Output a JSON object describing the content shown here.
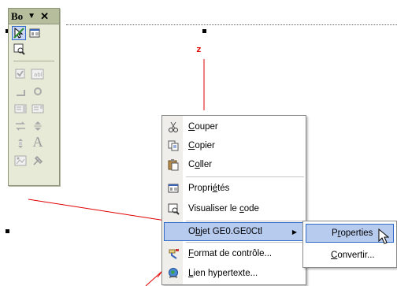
{
  "toolbox": {
    "title": "Bo",
    "title_dropdown": "▼",
    "close": "✕",
    "tools": [
      "select-objects-icon",
      "properties-icon",
      "view-code-icon",
      "checkbox-icon",
      "textbox-icon",
      "line-icon",
      "radio-icon",
      "listbox-icon",
      "combobox-icon",
      "scrollbar-icon",
      "spinner-icon",
      "scroll-icon",
      "label-icon",
      "image-icon",
      "more-controls-icon"
    ]
  },
  "canvas": {
    "axis_label": "z"
  },
  "context_menu": {
    "items": [
      {
        "icon": "scissors-icon",
        "label": "Couper",
        "accel": "C",
        "rest": "ouper"
      },
      {
        "icon": "copy-icon",
        "label": "Copier",
        "accel": "C",
        "rest": "opier"
      },
      {
        "icon": "paste-icon",
        "label": "Coller",
        "pre": "C",
        "accel": "o",
        "rest": "ller"
      },
      {
        "icon": "properties-icon",
        "label": "Propriétés",
        "pre": "Propri",
        "accel": "é",
        "rest": "tés"
      },
      {
        "icon": "view-code-icon",
        "label": "Visualiser le code",
        "pre": "Visualiser le ",
        "accel": "c",
        "rest": "ode"
      },
      {
        "icon": "",
        "label": "Objet GE0.GE0Ctl",
        "pre": "O",
        "accel": "b",
        "rest": "jet GE0.GE0Ctl",
        "selected": true
      },
      {
        "icon": "format-brush-icon",
        "label": "Format de contrôle...",
        "accel": "F",
        "rest": "ormat de contrôle..."
      },
      {
        "icon": "hyperlink-globe-icon",
        "label": "Lien hypertexte...",
        "accel": "L",
        "rest": "ien hypertexte..."
      }
    ]
  },
  "submenu": {
    "items": [
      {
        "label": "Properties",
        "pre": "P",
        "accel": "r",
        "rest": "operties",
        "selected": true
      },
      {
        "label": "Convertir...",
        "accel": "C",
        "rest": "onvertir..."
      }
    ]
  },
  "colors": {
    "menu_highlight": "#b7cbef",
    "highlight_border": "#316ac5",
    "axis_red": "#e00000",
    "toolbox_bg": "#e6ead6",
    "toolbox_title": "#b6bd9c"
  }
}
